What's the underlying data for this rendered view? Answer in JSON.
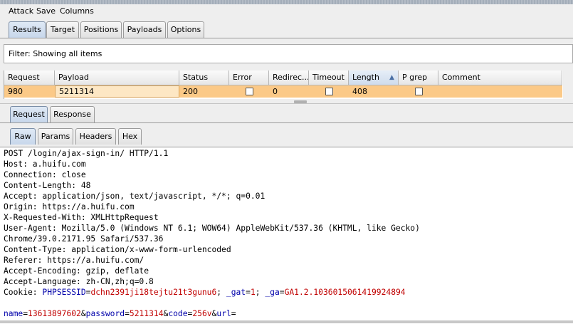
{
  "menubar": {
    "items": [
      "Attack",
      "Save",
      "Columns"
    ]
  },
  "main_tabs": [
    "Results",
    "Target",
    "Positions",
    "Payloads",
    "Options"
  ],
  "filter": {
    "text": "Filter: Showing all items"
  },
  "table": {
    "columns": [
      "Request",
      "Payload",
      "Status",
      "Error",
      "Redirec...",
      "Timeout",
      "Length",
      "P grep",
      "Comment"
    ],
    "sort_indicator": "▲",
    "row": {
      "request": "980",
      "payload": "5211314",
      "status": "200",
      "error": false,
      "redirects": "0",
      "timeout": false,
      "length": "408",
      "p_grep": false,
      "comment": ""
    },
    "row_color": "#fbc987"
  },
  "detail_tabs": [
    "Request",
    "Response"
  ],
  "view_tabs": [
    "Raw",
    "Params",
    "Headers",
    "Hex"
  ],
  "request_lines": [
    "POST /login/ajax-sign-in/ HTTP/1.1",
    "Host: a.huifu.com",
    "Connection: close",
    "Content-Length: 48",
    "Accept: application/json, text/javascript, */*; q=0.01",
    "Origin: https://a.huifu.com",
    "X-Requested-With: XMLHttpRequest",
    "User-Agent: Mozilla/5.0 (Windows NT 6.1; WOW64) AppleWebKit/537.36 (KHTML, like Gecko)",
    "Chrome/39.0.2171.95 Safari/537.36",
    "Content-Type: application/x-www-form-urlencoded",
    "Referer: https://a.huifu.com/",
    "Accept-Encoding: gzip, deflate",
    "Accept-Language: zh-CN,zh;q=0.8"
  ],
  "cookie": {
    "prefix": "Cookie: ",
    "k1": "PHPSESSID",
    "eq1": "=",
    "v1": "dchn2391ji18tejtu21t3gunu6",
    "sep1": "; ",
    "k2": "_gat",
    "eq2": "=",
    "v2": "1",
    "sep2": "; ",
    "k3": "_ga",
    "eq3": "=",
    "v3": "GA1.2.1036015061419924894"
  },
  "body": {
    "k1": "name",
    "eq1": "=",
    "v1": "13613897602",
    "amp1": "&",
    "k2": "password",
    "eq2": "=",
    "v2": "5211314",
    "amp2": "&",
    "k3": "code",
    "eq3": "=",
    "v3": "256v",
    "amp3": "&",
    "k4": "url",
    "eq4": "="
  },
  "colors": {
    "param_key": "#0000aa",
    "param_value": "#c00000",
    "selected_row": "#fbc987"
  }
}
